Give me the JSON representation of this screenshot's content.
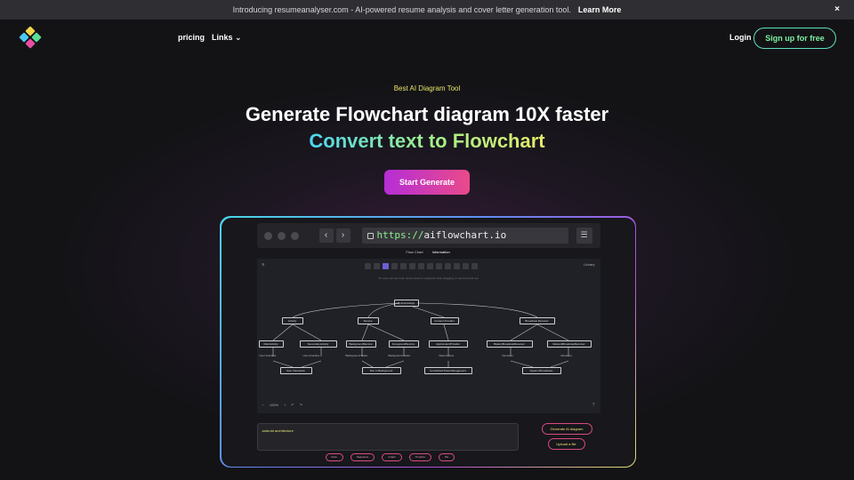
{
  "banner": {
    "text": "Introducing resumeanalyser.com - AI-powered resume analysis and cover letter generation tool.",
    "link": "Learn More",
    "close": "×"
  },
  "nav": {
    "pricing": "pricing",
    "links": "Links",
    "login": "Login",
    "signup": "Sign up for free"
  },
  "hero": {
    "tag": "Best AI Diagram Tool",
    "title": "Generate Flowchart diagram 10X faster",
    "subtitle": "Convert text to Flowchart",
    "cta": "Start Generate"
  },
  "preview": {
    "url_protocol": "https://",
    "url_host": "aiflowchart.io",
    "tabs": [
      "Flow Chart",
      "Information"
    ],
    "hint": "To move canvas, hold mouse wheel or spacebar while dragging, or use the hand tool",
    "share": "Library",
    "zoom": "100%",
    "diagram": {
      "root": "MyAndroidApp",
      "level1": [
        "Activity",
        "Service",
        "Content Provider",
        "Broadcast Receiver"
      ],
      "level2": [
        "MainActivity",
        "SecondaryActivity",
        "BackgroundService",
        "ForegroundService",
        "AppContentProvider",
        "BatteryBroadcastReceiver",
        "NetworkBroadcastReceiver"
      ],
      "level3": [
        "User Interface",
        "User Interface",
        "Background Tasks",
        "Background Tasks",
        "Data Access",
        "Receives",
        "Receives"
      ],
      "level4": [
        "User Interaction",
        "Run in Background",
        "Centralized Data Management",
        "System Broadcasts"
      ]
    },
    "prompt": "android architecture",
    "generate": "Generate AI diagram",
    "upload": "Upload a file",
    "chips": [
      "Flow",
      "Sequence",
      "Graph",
      "Timeline",
      "Pie"
    ]
  },
  "colors": {
    "accent_cyan": "#5fe0c0",
    "accent_pink": "#e84ea3",
    "tag_yellow": "#e7e36a",
    "background": "#131316"
  }
}
